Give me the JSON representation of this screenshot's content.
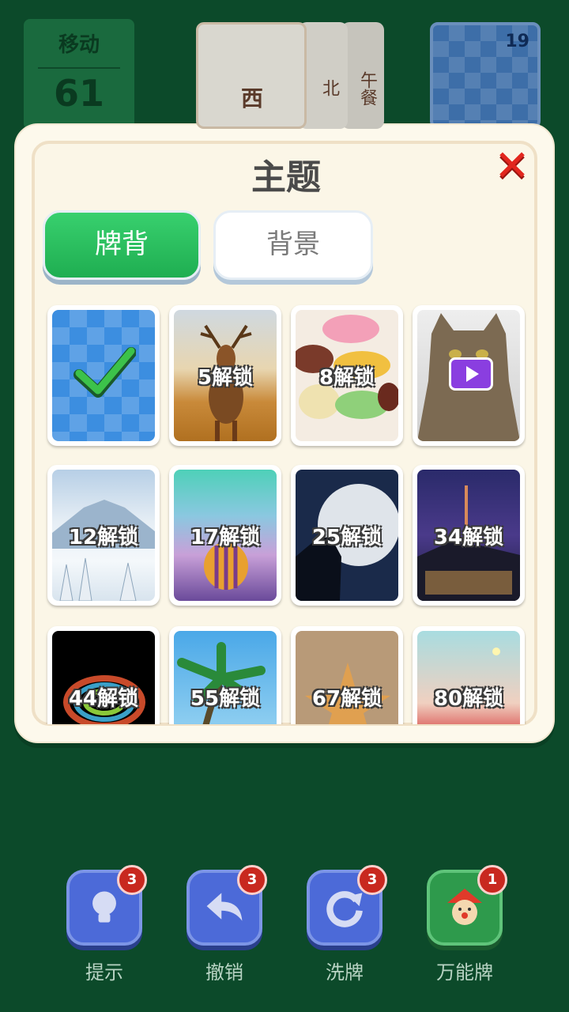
{
  "status": {
    "moves_label": "移动",
    "moves_value": "61",
    "deck_count": "19"
  },
  "tiles": [
    {
      "char": "西"
    },
    {
      "char": "北"
    },
    {
      "char": "午餐"
    }
  ],
  "theme_dialog": {
    "title": "主题",
    "close_icon": "close-x-icon",
    "tabs": [
      {
        "label": "牌背",
        "selected": true
      },
      {
        "label": "背景",
        "selected": false
      }
    ],
    "cards": [
      {
        "label": "",
        "state": "selected",
        "picture": "blue diamond pattern"
      },
      {
        "label": "5解锁",
        "state": "locked",
        "picture": "deer"
      },
      {
        "label": "8解锁",
        "state": "locked",
        "picture": "macarons"
      },
      {
        "label": "",
        "state": "video",
        "picture": "cat"
      },
      {
        "label": "12解锁",
        "state": "locked",
        "picture": "snowy mountain"
      },
      {
        "label": "17解锁",
        "state": "locked",
        "picture": "hot air balloon"
      },
      {
        "label": "25解锁",
        "state": "locked",
        "picture": "full moon"
      },
      {
        "label": "34解锁",
        "state": "locked",
        "picture": "city tower"
      },
      {
        "label": "44解锁",
        "state": "locked",
        "picture": "rainbow spiral"
      },
      {
        "label": "55解锁",
        "state": "locked",
        "picture": "palm tree"
      },
      {
        "label": "67解锁",
        "state": "locked",
        "picture": "starfish"
      },
      {
        "label": "80解锁",
        "state": "locked",
        "picture": "tulip field"
      }
    ]
  },
  "toolbar": [
    {
      "label": "提示",
      "badge": "3",
      "icon": "lightbulb-icon"
    },
    {
      "label": "撤销",
      "badge": "3",
      "icon": "undo-icon"
    },
    {
      "label": "洗牌",
      "badge": "3",
      "icon": "shuffle-icon"
    },
    {
      "label": "万能牌",
      "badge": "1",
      "icon": "joker-icon"
    }
  ],
  "colors": {
    "table_green": "#0c4a2a",
    "tab_active": "#1fae51",
    "close_red": "#e2261e",
    "tool_blue": "#4c6ad8"
  }
}
